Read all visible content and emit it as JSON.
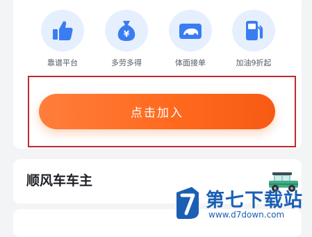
{
  "benefits": [
    {
      "label": "靠谱平台",
      "icon": "thumbs-up-icon"
    },
    {
      "label": "多劳多得",
      "icon": "money-bag-icon"
    },
    {
      "label": "体面接单",
      "icon": "car-order-icon"
    },
    {
      "label": "加油9折起",
      "icon": "fuel-pump-icon"
    }
  ],
  "cta": {
    "label": "点击加入"
  },
  "section": {
    "title": "顺风车车主"
  },
  "watermark": {
    "name": "第七下载站",
    "url": "www.d7down.com"
  },
  "colors": {
    "accent": "#ff6a1f",
    "icon_blue": "#3a7df0",
    "icon_bg": "#e6effd",
    "highlight_border": "#c0282c",
    "watermark": "#1a5fb4"
  }
}
